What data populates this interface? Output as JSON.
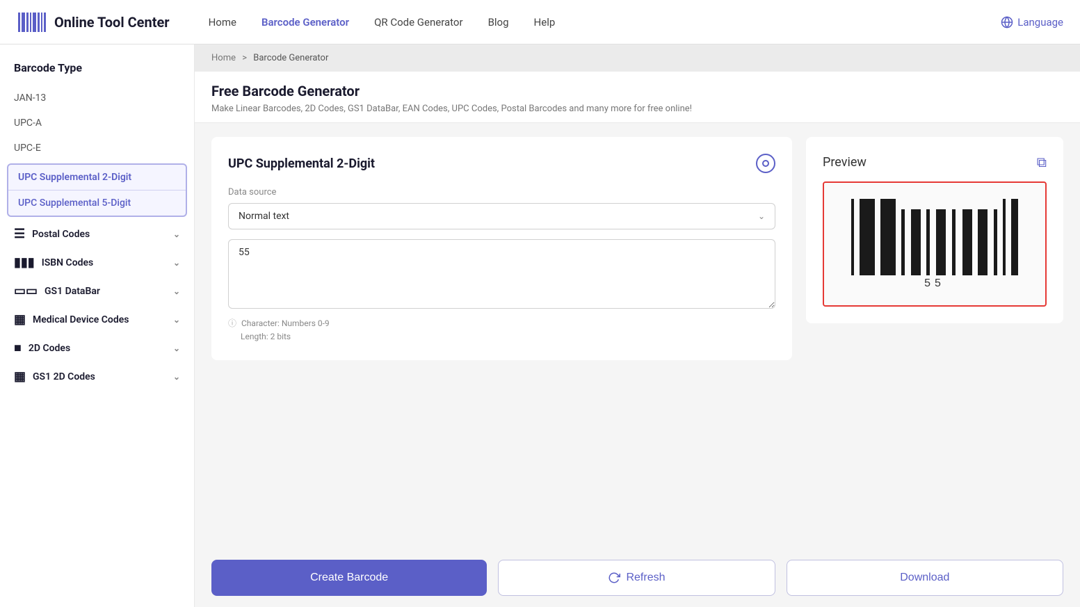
{
  "header": {
    "logo_text": "Online Tool Center",
    "nav": [
      {
        "label": "Home",
        "active": false,
        "id": "home"
      },
      {
        "label": "Barcode Generator",
        "active": true,
        "id": "barcode-generator"
      },
      {
        "label": "QR Code Generator",
        "active": false,
        "id": "qr-code-generator"
      },
      {
        "label": "Blog",
        "active": false,
        "id": "blog"
      },
      {
        "label": "Help",
        "active": false,
        "id": "help"
      }
    ],
    "language_label": "Language"
  },
  "sidebar": {
    "title": "Barcode Type",
    "simple_items": [
      {
        "label": "JAN-13",
        "id": "jan-13"
      },
      {
        "label": "UPC-A",
        "id": "upc-a"
      },
      {
        "label": "UPC-E",
        "id": "upc-e"
      }
    ],
    "active_group": {
      "item1": "UPC Supplemental 2-Digit",
      "item2": "UPC Supplemental 5-Digit"
    },
    "groups": [
      {
        "label": "Postal Codes",
        "icon": "postal",
        "id": "postal-codes"
      },
      {
        "label": "ISBN Codes",
        "icon": "isbn",
        "id": "isbn-codes"
      },
      {
        "label": "GS1 DataBar",
        "icon": "gs1databar",
        "id": "gs1-databar"
      },
      {
        "label": "Medical Device Codes",
        "icon": "medical",
        "id": "medical-device-codes"
      },
      {
        "label": "2D Codes",
        "icon": "2d",
        "id": "2d-codes"
      },
      {
        "label": "GS1 2D Codes",
        "icon": "gs1-2d",
        "id": "gs1-2d-codes"
      }
    ]
  },
  "breadcrumb": {
    "home": "Home",
    "separator": ">",
    "current": "Barcode Generator"
  },
  "page_header": {
    "title": "Free Barcode Generator",
    "subtitle": "Make Linear Barcodes, 2D Codes, GS1 DataBar, EAN Codes, UPC Codes, Postal Barcodes and many more for free online!"
  },
  "generator": {
    "title": "UPC Supplemental 2-Digit",
    "data_source_label": "Data source",
    "dropdown_value": "Normal text",
    "textarea_value": "55",
    "hint_character": "Character: Numbers 0-9",
    "hint_length": "Length: 2 bits"
  },
  "preview": {
    "title": "Preview",
    "barcode_number": "55"
  },
  "buttons": {
    "create": "Create Barcode",
    "refresh": "Refresh",
    "download": "Download"
  },
  "colors": {
    "accent": "#5b5fc7",
    "danger": "#e53935",
    "text_dark": "#1a1a2e",
    "text_muted": "#888"
  }
}
